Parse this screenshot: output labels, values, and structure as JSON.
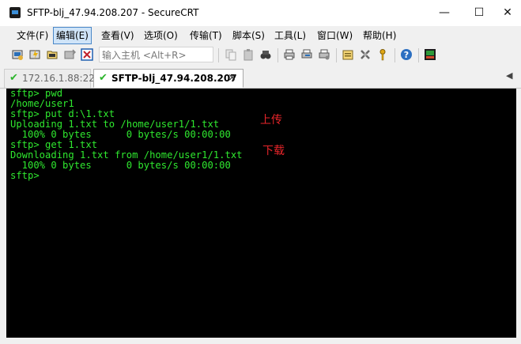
{
  "window": {
    "title": "SFTP-blj_47.94.208.207 - SecureCRT",
    "minimize": "—",
    "maximize": "☐",
    "close": "✕"
  },
  "menu": [
    {
      "label": "文件(F)"
    },
    {
      "label": "编辑(E)"
    },
    {
      "label": "查看(V)"
    },
    {
      "label": "选项(O)"
    },
    {
      "label": "传输(T)"
    },
    {
      "label": "脚本(S)"
    },
    {
      "label": "工具(L)"
    },
    {
      "label": "窗口(W)"
    },
    {
      "label": "帮助(H)"
    }
  ],
  "toolbar": {
    "host_placeholder": "输入主机 <Alt+R>"
  },
  "tabs": [
    {
      "label": "172.16.1.88:22",
      "active": false
    },
    {
      "label": "SFTP-blj_47.94.208.207",
      "active": true
    }
  ],
  "tab_close": "×",
  "tab_scroll": "◀",
  "terminal": {
    "lines": [
      "sftp> pwd",
      "/home/user1",
      "sftp> put d:\\1.txt",
      "Uploading 1.txt to /home/user1/1.txt",
      "  100% 0 bytes      0 bytes/s 00:00:00",
      "sftp> get 1.txt",
      "Downloading 1.txt from /home/user1/1.txt",
      "  100% 0 bytes      0 bytes/s 00:00:00",
      "sftp>"
    ],
    "annotation_upload": "上传",
    "annotation_download": "下载"
  },
  "colors": {
    "terminal_bg": "#000000",
    "terminal_fg": "#2fe82f",
    "annotation": "#e8252a"
  }
}
